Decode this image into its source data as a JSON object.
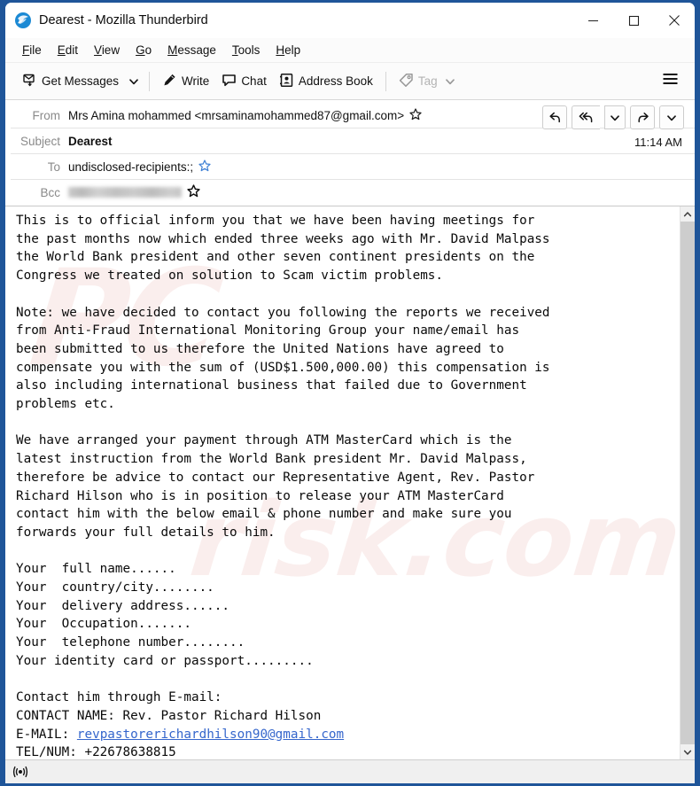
{
  "window": {
    "title": "Dearest - Mozilla Thunderbird",
    "logo_icon": "thunderbird-logo-icon",
    "controls": {
      "minimize": "minimize-icon",
      "maximize": "maximize-icon",
      "close": "close-icon"
    }
  },
  "menubar": {
    "items": [
      {
        "label": "File",
        "accel": "F"
      },
      {
        "label": "Edit",
        "accel": "E"
      },
      {
        "label": "View",
        "accel": "V"
      },
      {
        "label": "Go",
        "accel": "G"
      },
      {
        "label": "Message",
        "accel": "M"
      },
      {
        "label": "Tools",
        "accel": "T"
      },
      {
        "label": "Help",
        "accel": "H"
      }
    ]
  },
  "toolbar": {
    "get_messages_label": "Get Messages",
    "get_messages_icon": "get-messages-icon",
    "get_messages_caret": "chevron-down-icon",
    "write_label": "Write",
    "write_icon": "pencil-icon",
    "chat_label": "Chat",
    "chat_icon": "chat-bubble-icon",
    "address_book_label": "Address Book",
    "address_book_icon": "address-book-icon",
    "tag_label": "Tag",
    "tag_icon": "tag-icon",
    "tag_caret": "chevron-down-icon",
    "tag_disabled": true,
    "app_menu_icon": "hamburger-menu-icon"
  },
  "message_header": {
    "from_label": "From",
    "from_value": "Mrs Amina mohammed <mrsaminamohammed87@gmail.com>",
    "subject_label": "Subject",
    "subject_value": "Dearest",
    "to_label": "To",
    "to_value": "undisclosed-recipients:;",
    "bcc_label": "Bcc",
    "bcc_value": "",
    "timestamp": "11:14 AM",
    "star_icon": "star-icon",
    "actions": [
      {
        "name": "reply-button",
        "icon": "reply-icon"
      },
      {
        "name": "reply-all-button",
        "icon": "reply-all-icon"
      },
      {
        "name": "reply-dropdown-button",
        "icon": "chevron-down-icon"
      },
      {
        "name": "forward-button",
        "icon": "forward-arrow-icon"
      },
      {
        "name": "more-actions-button",
        "icon": "chevron-down-icon"
      }
    ]
  },
  "body": {
    "watermark_text": "PC",
    "watermark_text2": "risk.com",
    "paragraph1": "This is to official inform you that we have been having meetings for\nthe past months now which ended three weeks ago with Mr. David Malpass\nthe World Bank president and other seven continent presidents on the\nCongress we treated on solution to Scam victim problems.",
    "paragraph2": "Note: we have decided to contact you following the reports we received\nfrom Anti-Fraud International Monitoring Group your name/email has\nbeen submitted to us therefore the United Nations have agreed to\ncompensate you with the sum of (USD$1.500,000.00) this compensation is\nalso including international business that failed due to Government\nproblems etc.",
    "paragraph3": "We have arranged your payment through ATM MasterCard which is the\nlatest instruction from the World Bank president Mr. David Malpass,\ntherefore be advice to contact our Representative Agent, Rev. Pastor\nRichard Hilson who is in position to release your ATM MasterCard\ncontact him with the below email & phone number and make sure you\nforwards your full details to him.",
    "details_list": "Your  full name......\nYour  country/city........\nYour  delivery address......\nYour  Occupation.......\nYour  telephone number........\nYour identity card or passport.........",
    "contact_intro": "Contact him through E-mail:",
    "contact_name": "CONTACT NAME: Rev. Pastor Richard Hilson",
    "email_label": "E-MAIL: ",
    "email_link": "revpastorerichardhilson90@gmail.com",
    "tel_line": "TEL/NUM: +22678638815"
  },
  "scrollbar": {
    "up_icon": "chevron-up-icon",
    "down_icon": "chevron-down-icon"
  },
  "statusbar": {
    "online_icon": "broadcast-online-icon"
  },
  "colors": {
    "window_border": "#1f5599",
    "link": "#3566cc",
    "label_grey": "#8a8a8a",
    "toolbar_bg": "#fbfbfb"
  }
}
